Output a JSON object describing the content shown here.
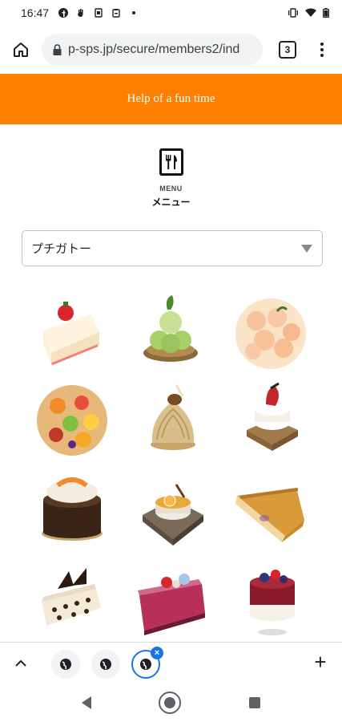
{
  "status_bar": {
    "time": "16:47",
    "left_icons": [
      "facebook-icon",
      "hand-icon",
      "screenshot-icon",
      "clipboard-icon",
      "dot-icon"
    ],
    "right_icons": [
      "vibrate-icon",
      "wifi-icon",
      "battery-icon"
    ]
  },
  "browser": {
    "url": "p-sps.jp/secure/members2/ind",
    "tab_count": "3"
  },
  "banner": {
    "text": "Help of a fun time",
    "color": "#ff7f00"
  },
  "menu_header": {
    "label_en": "MENU",
    "label_ja": "メニュー"
  },
  "category_select": {
    "selected": "プチガトー"
  },
  "cakes": [
    {
      "id": "shortcake"
    },
    {
      "id": "melon-cake"
    },
    {
      "id": "peach-tart"
    },
    {
      "id": "fruit-tart"
    },
    {
      "id": "mont-blanc"
    },
    {
      "id": "strawberry-decor-cake"
    },
    {
      "id": "chocolate-dome"
    },
    {
      "id": "orange-mousse"
    },
    {
      "id": "apple-pie"
    },
    {
      "id": "chocolate-layer-cake"
    },
    {
      "id": "berry-mousse"
    },
    {
      "id": "berry-cup-cake"
    }
  ],
  "tab_strip": {
    "tabs": [
      "globe-icon",
      "globe-icon",
      "globe-icon"
    ],
    "active_index": 2,
    "add_label": "+"
  }
}
